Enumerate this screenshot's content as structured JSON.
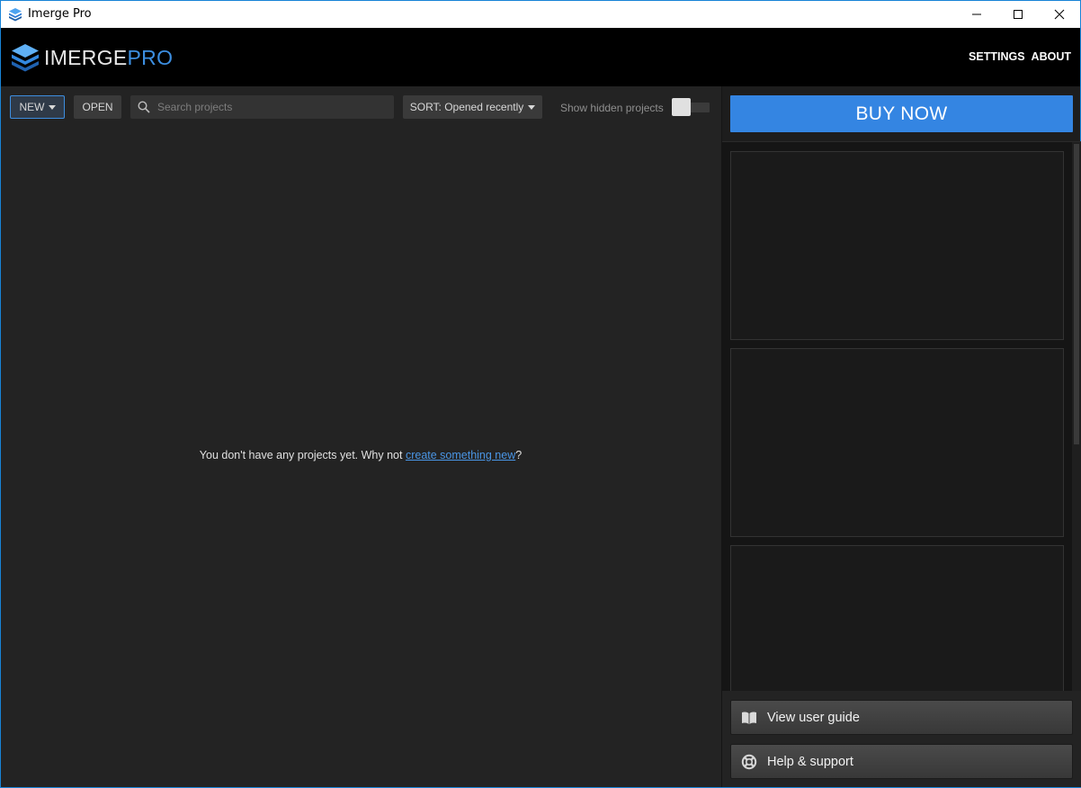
{
  "window": {
    "title": "Imerge Pro",
    "controls": [
      "minimize-icon",
      "maximize-icon",
      "close-icon"
    ]
  },
  "header": {
    "logo_primary": "IMERGE",
    "logo_secondary": "PRO",
    "nav": {
      "settings": "SETTINGS",
      "about": "ABOUT"
    },
    "accent": "#3c8ee0"
  },
  "toolbar": {
    "new_label": "NEW",
    "open_label": "OPEN",
    "search_placeholder": "Search projects",
    "sort_label": "SORT: Opened recently",
    "hidden_label": "Show hidden projects",
    "hidden_toggle_on": false
  },
  "projects": {
    "empty_prefix": "You don't have any projects yet. Why not ",
    "empty_link": "create something new",
    "empty_suffix": "?"
  },
  "sidebar": {
    "buy_label": "BUY NOW",
    "buy_color": "#3485e2",
    "actions": [
      {
        "label": "View user guide",
        "icon": "book-icon"
      },
      {
        "label": "Help & support",
        "icon": "lifebuoy-icon"
      }
    ]
  }
}
